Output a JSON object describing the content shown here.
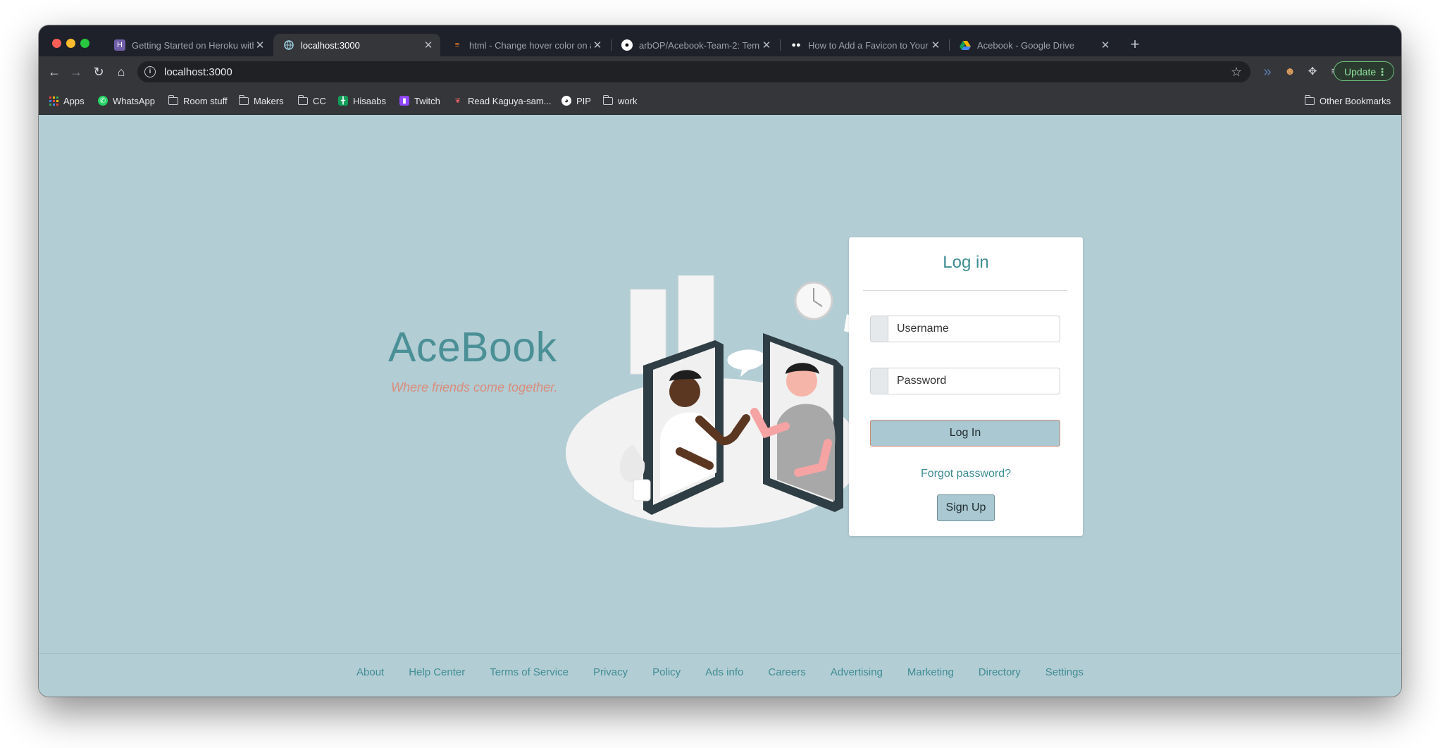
{
  "browser": {
    "tabs": [
      {
        "title": "Getting Started on Heroku with",
        "icon": "heroku-icon",
        "active": false
      },
      {
        "title": "localhost:3000",
        "icon": "globe-icon",
        "active": true
      },
      {
        "title": "html - Change hover color on a",
        "icon": "stackoverflow-icon",
        "active": false
      },
      {
        "title": "arbOP/Acebook-Team-2: Temp",
        "icon": "github-icon",
        "active": false
      },
      {
        "title": "How to Add a Favicon to Your R",
        "icon": "medium-icon",
        "active": false
      },
      {
        "title": "Acebook - Google Drive",
        "icon": "google-drive-icon",
        "active": false
      }
    ],
    "url": "localhost:3000",
    "update_label": "Update",
    "bookmarks": [
      {
        "label": "Apps",
        "icon": "apps-grid-icon"
      },
      {
        "label": "WhatsApp",
        "icon": "whatsapp-icon"
      },
      {
        "label": "Room stuff",
        "icon": "folder-icon"
      },
      {
        "label": "Makers",
        "icon": "folder-icon"
      },
      {
        "label": "CC",
        "icon": "folder-icon"
      },
      {
        "label": "Hisaabs",
        "icon": "sheets-icon"
      },
      {
        "label": "Twitch",
        "icon": "twitch-icon"
      },
      {
        "label": "Read Kaguya-sam...",
        "icon": "site-icon"
      },
      {
        "label": "PIP",
        "icon": "globe-icon"
      },
      {
        "label": "work",
        "icon": "folder-icon"
      }
    ],
    "other_bookmarks": "Other Bookmarks"
  },
  "brand": {
    "name": "AceBook",
    "tagline": "Where friends come together."
  },
  "login": {
    "title": "Log in",
    "username_placeholder": "Username",
    "password_placeholder": "Password",
    "submit_label": "Log In",
    "forgot_label": "Forgot password?",
    "signup_label": "Sign Up"
  },
  "footer": {
    "links": [
      "About",
      "Help Center",
      "Terms of Service",
      "Privacy",
      "Policy",
      "Ads info",
      "Careers",
      "Advertising",
      "Marketing",
      "Directory",
      "Settings"
    ]
  },
  "colors": {
    "page_bg": "#b3cdd5",
    "brand": "#4a9096",
    "tagline": "#d98c7a",
    "link": "#3f8d93"
  }
}
